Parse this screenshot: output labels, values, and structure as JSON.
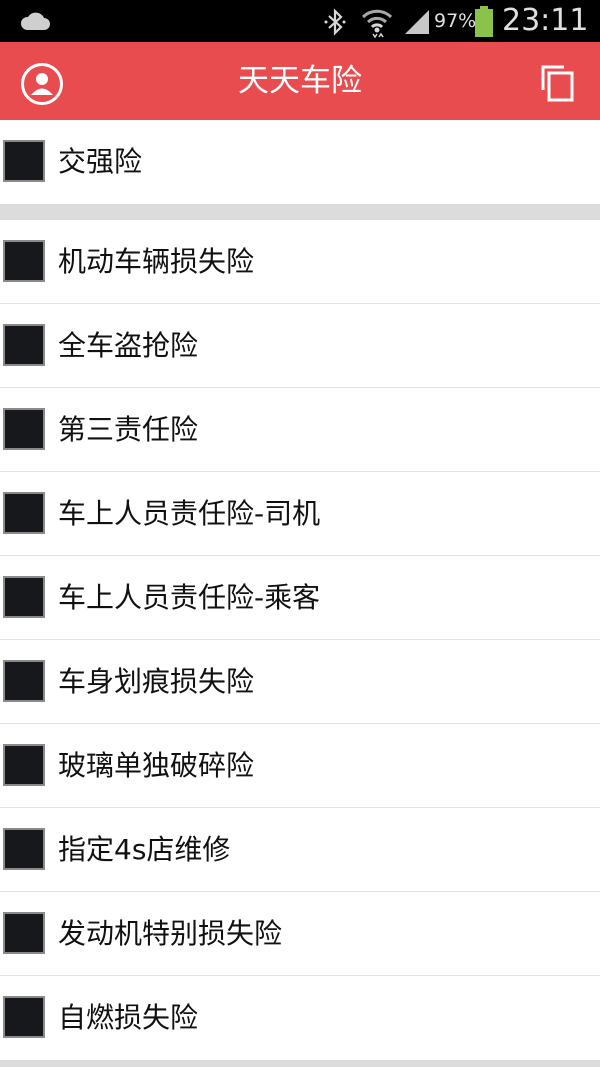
{
  "status_bar": {
    "battery_percent": "97%",
    "time": "23:11"
  },
  "app_bar": {
    "title": "天天车险"
  },
  "colors": {
    "accent": "#e84c4f",
    "battery": "#8bc34a"
  },
  "insurance_items": [
    {
      "label": "交强险"
    },
    {
      "label": "机动车辆损失险"
    },
    {
      "label": "全车盗抢险"
    },
    {
      "label": "第三责任险"
    },
    {
      "label": "车上人员责任险-司机"
    },
    {
      "label": "车上人员责任险-乘客"
    },
    {
      "label": "车身划痕损失险"
    },
    {
      "label": "玻璃单独破碎险"
    },
    {
      "label": "指定4s店维修"
    },
    {
      "label": "发动机特别损失险"
    },
    {
      "label": "自燃损失险"
    }
  ]
}
